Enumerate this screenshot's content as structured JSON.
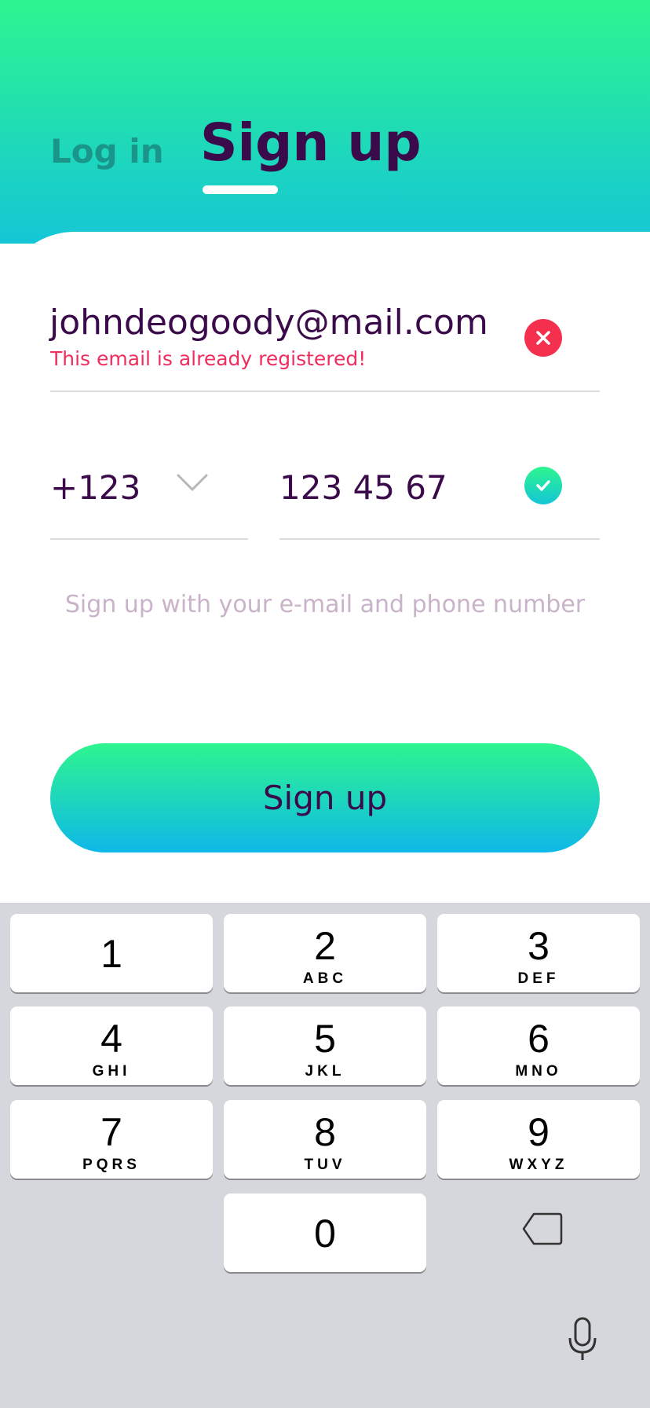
{
  "tabs": {
    "login_label": "Log in",
    "signup_label": "Sign up"
  },
  "form": {
    "email_value": "johndeogoody@mail.com",
    "email_error": "This email is already registered!",
    "country_code": "+123",
    "phone_value": "123 45 67",
    "hint": "Sign up with your e-mail and phone number",
    "submit_label": "Sign up"
  },
  "keyboard": {
    "keys": [
      {
        "num": "1",
        "letters": ""
      },
      {
        "num": "2",
        "letters": "ABC"
      },
      {
        "num": "3",
        "letters": "DEF"
      },
      {
        "num": "4",
        "letters": "GHI"
      },
      {
        "num": "5",
        "letters": "JKL"
      },
      {
        "num": "6",
        "letters": "MNO"
      },
      {
        "num": "7",
        "letters": "PQRS"
      },
      {
        "num": "8",
        "letters": "TUV"
      },
      {
        "num": "9",
        "letters": "WXYZ"
      },
      {
        "num": "0",
        "letters": ""
      }
    ]
  },
  "colors": {
    "accent_green": "#2ef58f",
    "accent_cyan": "#14c6d6",
    "title": "#3b0a4a",
    "error": "#f5304f"
  },
  "icons": [
    "error-x-icon",
    "chevron-down-icon",
    "check-icon",
    "backspace-icon",
    "microphone-icon"
  ]
}
